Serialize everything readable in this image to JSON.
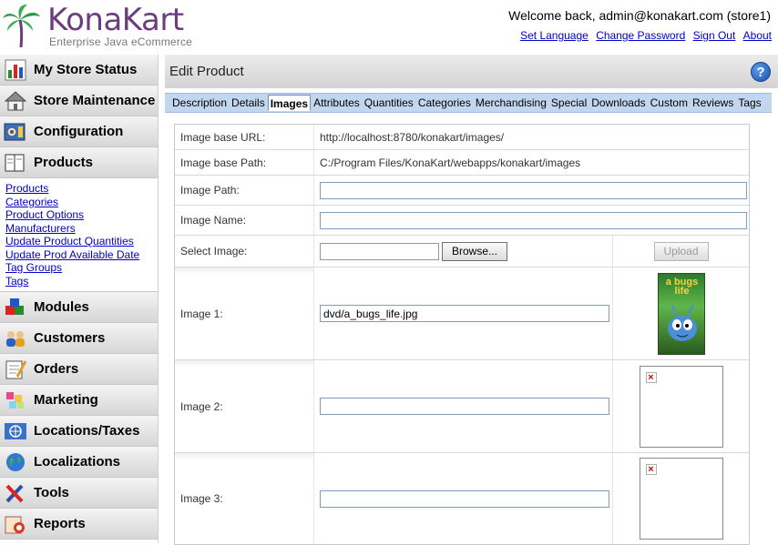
{
  "header": {
    "brand": "KonaKart",
    "tagline": "Enterprise Java eCommerce",
    "welcome": "Welcome back, admin@konakart.com (store1)",
    "links": [
      "Set Language",
      "Change Password",
      "Sign Out",
      "About"
    ]
  },
  "sidebar": {
    "items": [
      {
        "label": "My Store Status",
        "icon": "bar-chart-icon"
      },
      {
        "label": "Store Maintenance",
        "icon": "house-icon"
      },
      {
        "label": "Configuration",
        "icon": "settings-icon"
      },
      {
        "label": "Products",
        "icon": "book-icon"
      },
      {
        "label": "Modules",
        "icon": "blocks-icon"
      },
      {
        "label": "Customers",
        "icon": "users-icon"
      },
      {
        "label": "Orders",
        "icon": "notepad-icon"
      },
      {
        "label": "Marketing",
        "icon": "palette-icon"
      },
      {
        "label": "Locations/Taxes",
        "icon": "globe-flag-icon"
      },
      {
        "label": "Localizations",
        "icon": "globe-icon"
      },
      {
        "label": "Tools",
        "icon": "tools-icon"
      },
      {
        "label": "Reports",
        "icon": "reports-icon"
      }
    ],
    "product_links": [
      "Products",
      "Categories",
      "Product Options",
      "Manufacturers",
      "Update Product Quantities",
      "Update Prod Available Date",
      "Tag Groups",
      "Tags"
    ]
  },
  "main": {
    "title": "Edit Product",
    "help": "?",
    "tabs": [
      "Description",
      "Details",
      "Images",
      "Attributes",
      "Quantities",
      "Categories",
      "Merchandising",
      "Special",
      "Downloads",
      "Custom",
      "Reviews",
      "Tags"
    ],
    "active_tab": "Images"
  },
  "form": {
    "image_base_url_label": "Image base URL:",
    "image_base_url": "http://localhost:8780/konakart/images/",
    "image_base_path_label": "Image base Path:",
    "image_base_path": "C:/Program Files/KonaKart/webapps/konakart/images",
    "image_path_label": "Image Path:",
    "image_path": "",
    "image_name_label": "Image Name:",
    "image_name": "",
    "select_image_label": "Select Image:",
    "browse_label": "Browse...",
    "upload_label": "Upload",
    "image1_label": "Image 1:",
    "image1_value": "dvd/a_bugs_life.jpg",
    "image1_thumb_text": "a bugs life",
    "image2_label": "Image 2:",
    "image2_value": "",
    "image3_label": "Image 3:",
    "image3_value": ""
  },
  "colors": {
    "brand": "#6a3d7e",
    "link": "#0000cc",
    "tab_bar": "#c2d7ef"
  }
}
